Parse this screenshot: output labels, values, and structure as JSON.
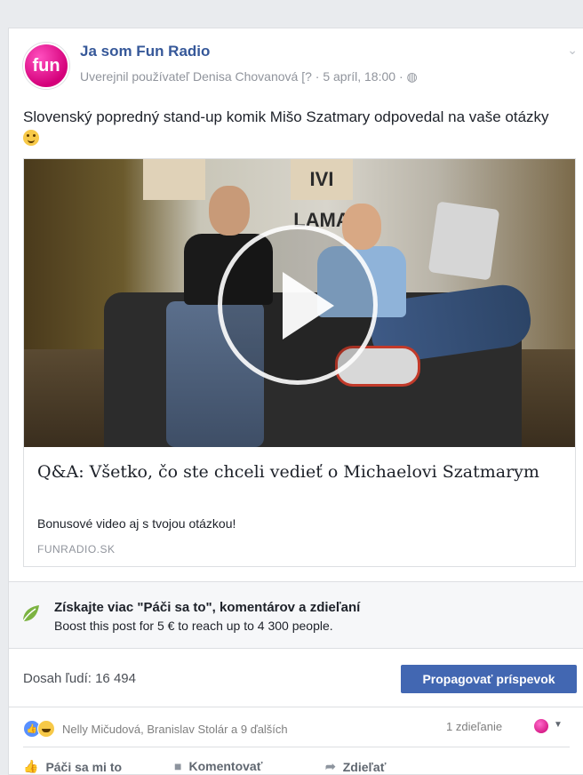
{
  "post": {
    "page_name": "Ja som Fun Radio",
    "logo_text": "fun",
    "meta": "Uverejnil používateľ Denisa Chovanová [? · 5 apríl, 18:00 · ",
    "globe": "◍",
    "text": "Slovenský popredný stand-up komik Mišo Szatmary odpovedal na vaše otázky "
  },
  "link": {
    "poster_text": "IVI LAMA",
    "title": "Q&A: Všetko, čo ste chceli vedieť o Michaelovi Szatmarym",
    "description": "Bonusové video aj s tvojou otázkou!",
    "domain": "FUNRADIO.SK"
  },
  "boost": {
    "title": "Získajte viac \"Páči sa to\", komentárov a zdieľaní",
    "subtitle": "Boost this post for 5 € to reach up to 4 300 people."
  },
  "stats": {
    "reach": "Dosah ľudí: 16 494",
    "promote_label": "Propagovať príspevok",
    "reactions_text": "Nelly Mičudová, Branislav Stolár a 9 ďalších",
    "shares": "1 zdieľanie"
  },
  "actions": {
    "like": "Páči sa mi to",
    "comment": "Komentovať",
    "share": "Zdieľať"
  },
  "colors": {
    "link_blue": "#365899",
    "button_blue": "#4267b2",
    "brand_pink": "#d4007a"
  }
}
